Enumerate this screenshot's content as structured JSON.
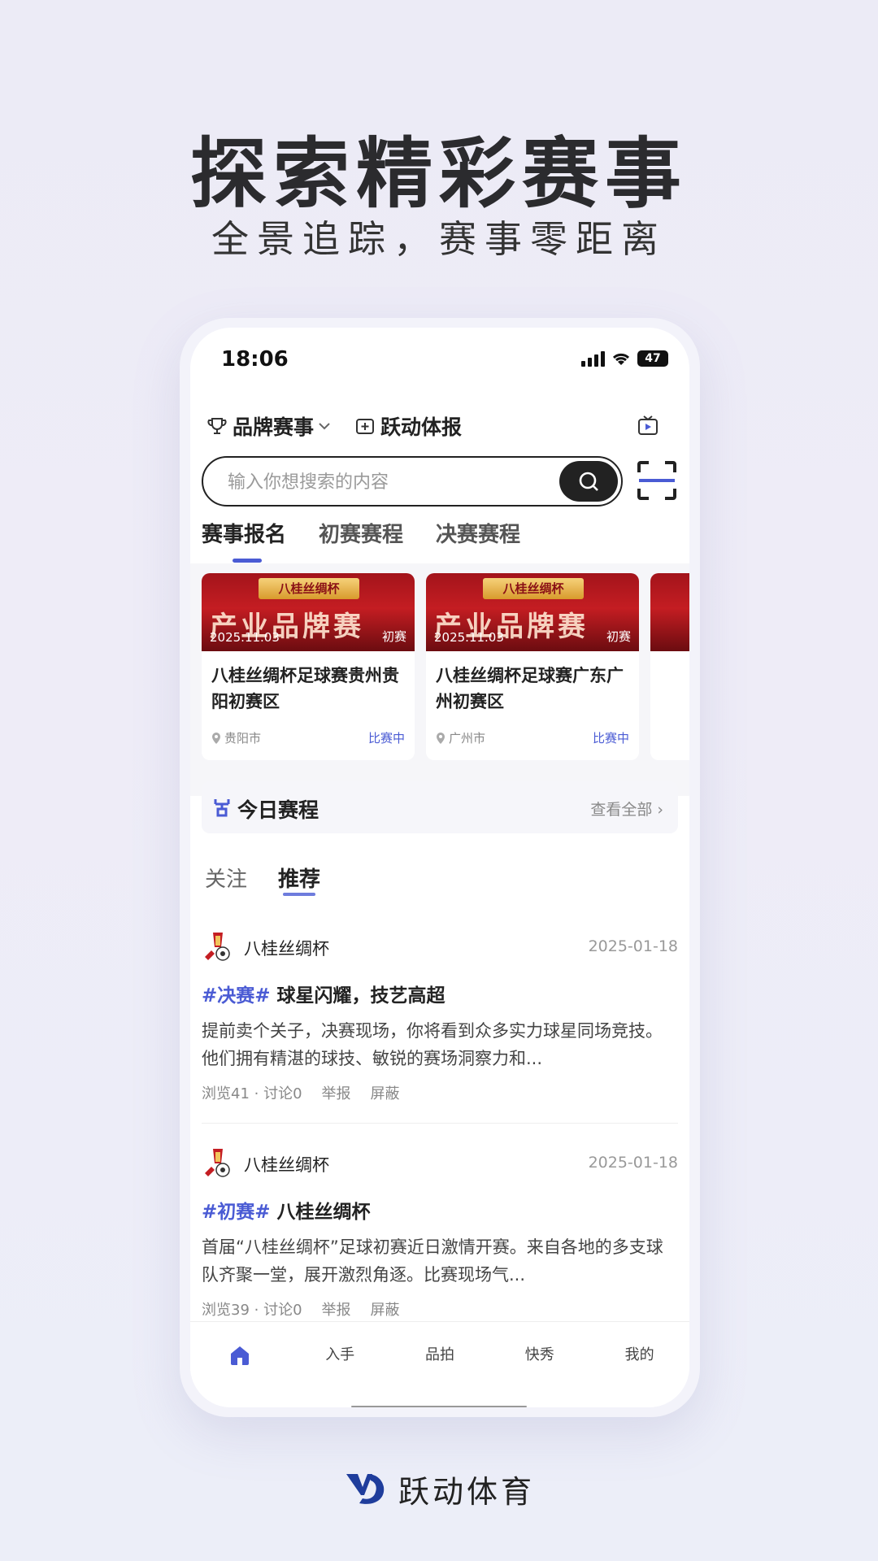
{
  "hero": {
    "title": "探索精彩赛事",
    "subtitle": "全景追踪，赛事零距离"
  },
  "status_bar": {
    "time": "18:06",
    "battery": "47"
  },
  "topnav": {
    "item1": "品牌赛事",
    "item2": "跃动体报"
  },
  "search": {
    "placeholder": "输入你想搜索的内容"
  },
  "tabs": [
    "赛事报名",
    "初赛赛程",
    "决赛赛程"
  ],
  "cards": [
    {
      "banner": "八桂丝绸杯",
      "big_text": "产业品牌赛",
      "date": "2025.11.03",
      "stage": "初赛",
      "title": "八桂丝绸杯足球赛贵州贵阳初赛区",
      "location": "贵阳市",
      "status": "比赛中"
    },
    {
      "banner": "八桂丝绸杯",
      "big_text": "产业品牌赛",
      "date": "2025.11.03",
      "stage": "初赛",
      "title": "八桂丝绸杯足球赛广东广州初赛区",
      "location": "广州市",
      "status": "比赛中"
    }
  ],
  "today": {
    "title": "今日赛程",
    "more": "查看全部 ›"
  },
  "subtabs": [
    "关注",
    "推荐"
  ],
  "posts": [
    {
      "author": "八桂丝绸杯",
      "date": "2025-01-18",
      "tag": "#决赛#",
      "title": "球星闪耀，技艺高超",
      "body": "提前卖个关子，决赛现场，你将看到众多实力球星同场竞技。他们拥有精湛的球技、敏锐的赛场洞察力和...",
      "views": "浏览41 · 讨论0",
      "report": "举报",
      "block": "屏蔽"
    },
    {
      "author": "八桂丝绸杯",
      "date": "2025-01-18",
      "tag": "#初赛#",
      "title": "八桂丝绸杯",
      "body": "首届“八桂丝绸杯”足球初赛近日激情开赛。来自各地的多支球队齐聚一堂，展开激烈角逐。比赛现场气...",
      "views": "浏览39 · 讨论0",
      "report": "举报",
      "block": "屏蔽"
    }
  ],
  "bottom_nav": [
    "入手",
    "品拍",
    "快秀",
    "我的"
  ],
  "brand": {
    "name": "跃动体育"
  },
  "colors": {
    "accent": "#4a5bd4",
    "dark": "#222222",
    "banner_red": "#c41d22"
  }
}
